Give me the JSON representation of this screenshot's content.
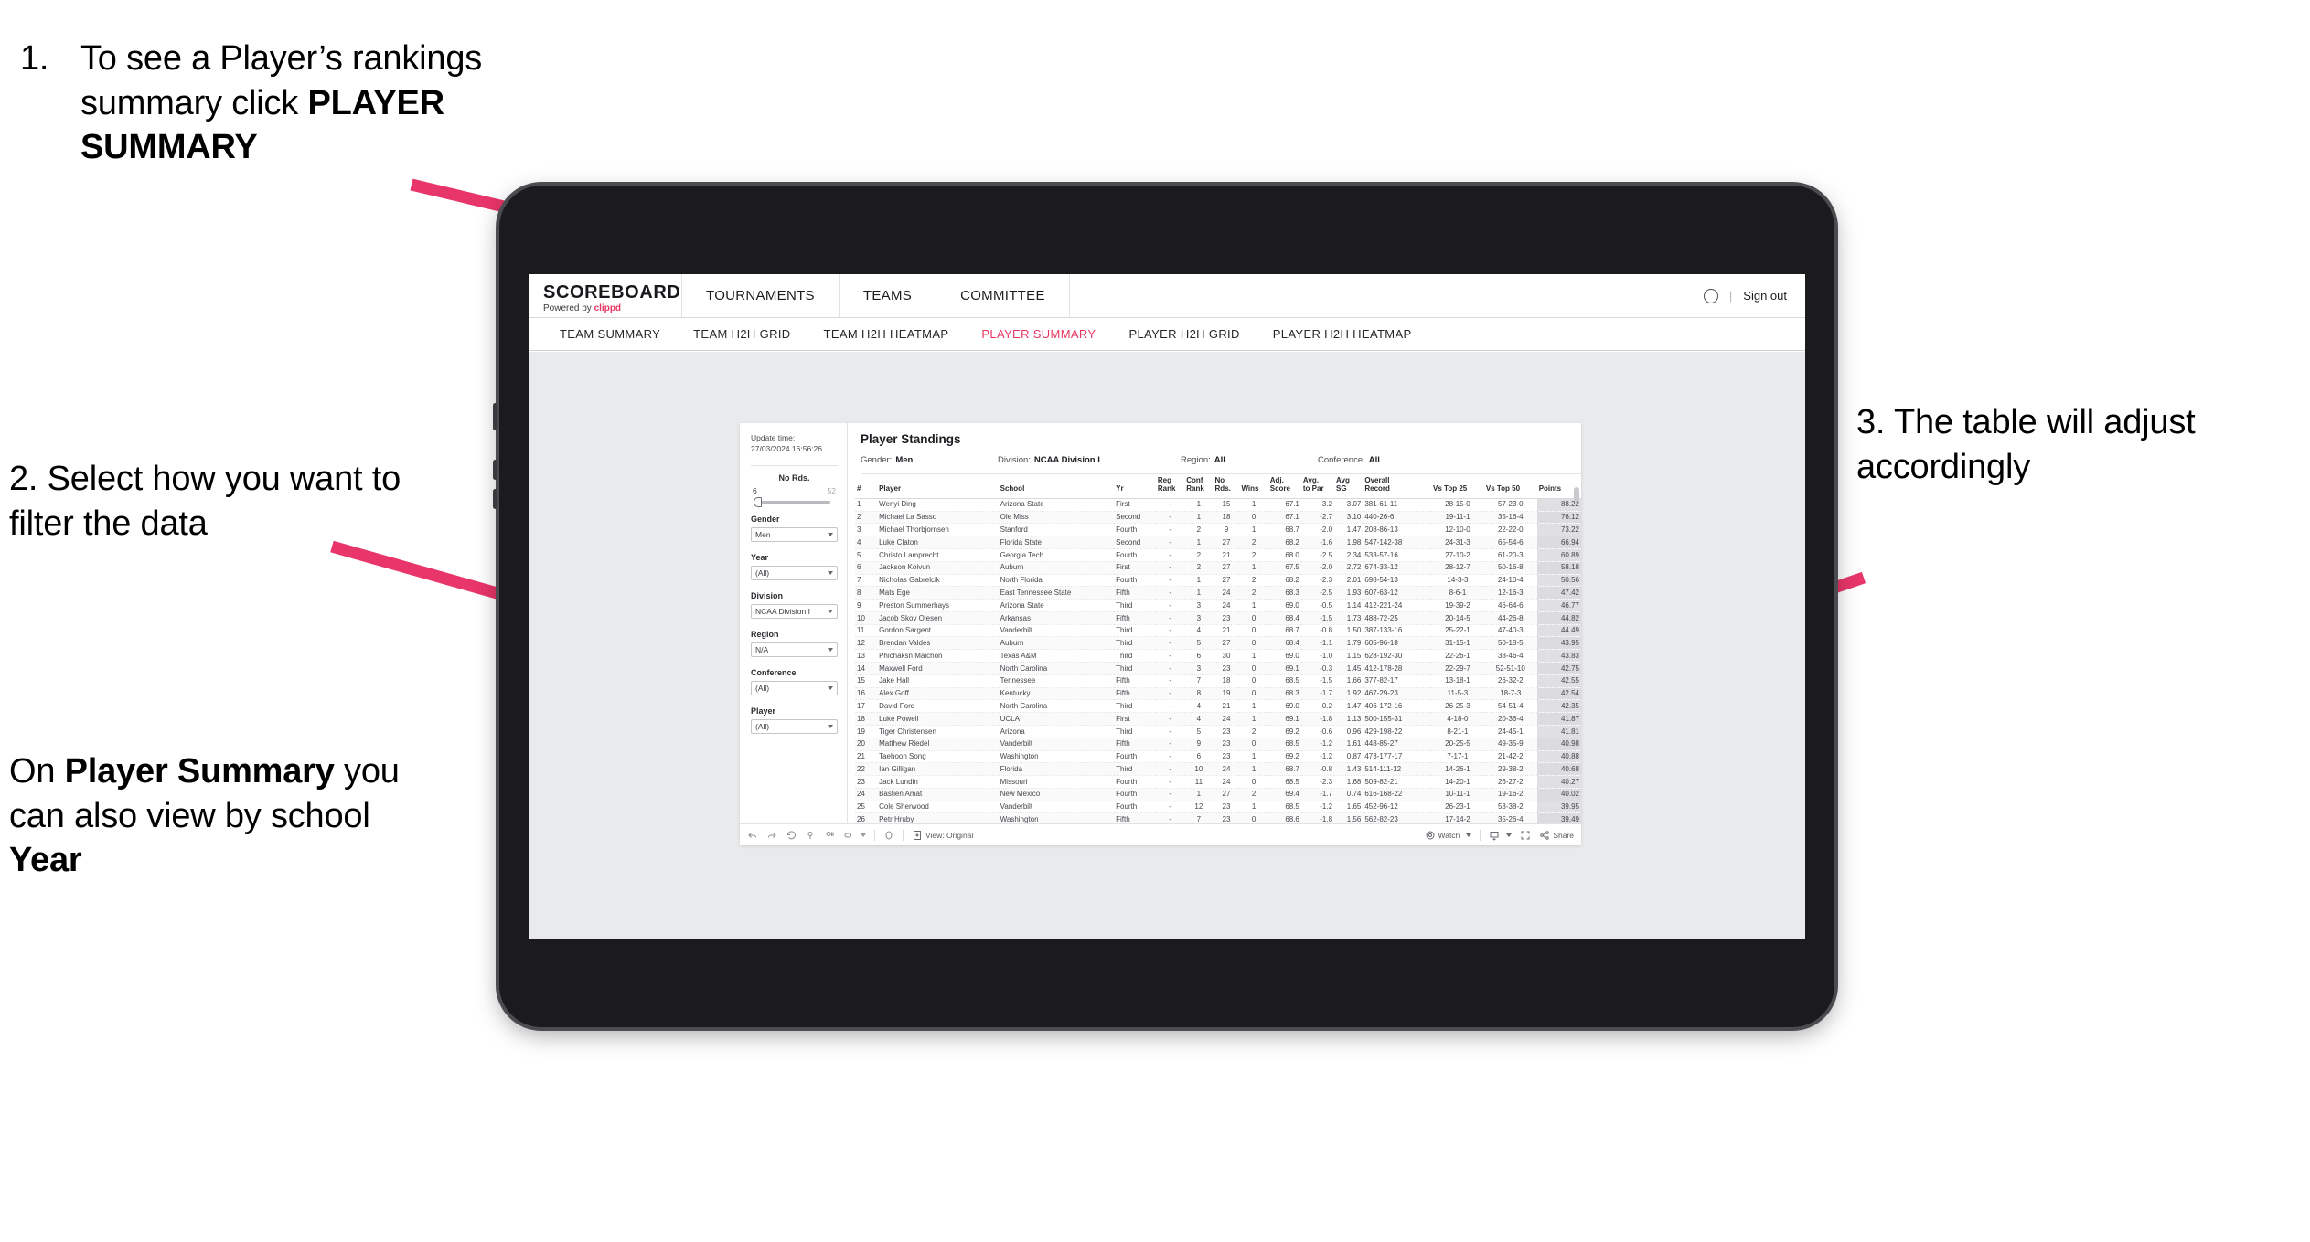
{
  "annotations": {
    "step1": {
      "number": "1.",
      "text_before": "To see a Player’s rankings summary click ",
      "bold": "PLAYER SUMMARY"
    },
    "step2": {
      "line": "2. Select how you want to filter the data"
    },
    "step3": {
      "pre": "On ",
      "bold1": "Player Summary",
      "mid": " you can also view by school ",
      "bold2": "Year"
    },
    "step4": {
      "line": "3. The table will adjust accordingly"
    },
    "accent_color": "#e8356a"
  },
  "app": {
    "brand": {
      "logo": "SCOREBOARD",
      "powered_prefix": "Powered by ",
      "powered_brand": "clippd"
    },
    "topnav": [
      "TOURNAMENTS",
      "TEAMS",
      "COMMITTEE"
    ],
    "topbar_right": {
      "divider": "|",
      "sign_out": "Sign out"
    },
    "subnav": {
      "items": [
        "TEAM SUMMARY",
        "TEAM H2H GRID",
        "TEAM H2H HEATMAP",
        "PLAYER SUMMARY",
        "PLAYER H2H GRID",
        "PLAYER H2H HEATMAP"
      ],
      "active_index": 3,
      "active_color": "#e8355f"
    }
  },
  "viz": {
    "update_time_label": "Update time:",
    "update_time_value": "27/03/2024 16:56:26",
    "title": "Player Standings",
    "subfilters": [
      {
        "label": "Gender:",
        "value": "Men"
      },
      {
        "label": "Division:",
        "value": "NCAA Division I"
      },
      {
        "label": "Region:",
        "value": "All"
      },
      {
        "label": "Conference:",
        "value": "All"
      }
    ],
    "slider": {
      "label": "No Rds.",
      "min": "6",
      "max": "52",
      "value": "6"
    },
    "filters": [
      {
        "label": "Gender",
        "value": "Men"
      },
      {
        "label": "Year",
        "value": "(All)"
      },
      {
        "label": "Division",
        "value": "NCAA Division I"
      },
      {
        "label": "Region",
        "value": "N/A"
      },
      {
        "label": "Conference",
        "value": "(All)"
      },
      {
        "label": "Player",
        "value": "(All)"
      }
    ],
    "toolbar": {
      "view_label": "View: Original",
      "watch_label": "Watch",
      "share_label": "Share"
    }
  },
  "table": {
    "columns": [
      "#",
      "Player",
      "School",
      "Yr",
      "Reg Rank",
      "Conf Rank",
      "No Rds.",
      "Wins",
      "Adj. Score",
      "Avg. to Par",
      "Avg SG",
      "Overall Record",
      "Vs Top 25",
      "Vs Top 50",
      "Points"
    ],
    "columns_wrapped": [
      [
        "#",
        ""
      ],
      [
        "Player",
        ""
      ],
      [
        "School",
        ""
      ],
      [
        "Yr",
        ""
      ],
      [
        "Reg",
        "Rank"
      ],
      [
        "Conf",
        "Rank"
      ],
      [
        "No",
        "Rds."
      ],
      [
        "",
        "Wins"
      ],
      [
        "Adj.",
        "Score"
      ],
      [
        "Avg.",
        "to Par"
      ],
      [
        "Avg",
        "SG"
      ],
      [
        "Overall",
        "Record"
      ],
      [
        "",
        "Vs Top 25"
      ],
      [
        "",
        "Vs Top 50"
      ],
      [
        "",
        "Points"
      ]
    ],
    "rows": [
      [
        "1",
        "Wenyi Ding",
        "Arizona State",
        "First",
        "-",
        "1",
        "15",
        "1",
        "67.1",
        "-3.2",
        "3.07",
        "381-61-11",
        "28-15-0",
        "57-23-0",
        "88.22"
      ],
      [
        "2",
        "Michael La Sasso",
        "Ole Miss",
        "Second",
        "-",
        "1",
        "18",
        "0",
        "67.1",
        "-2.7",
        "3.10",
        "440-26-6",
        "19-11-1",
        "35-16-4",
        "76.12"
      ],
      [
        "3",
        "Michael Thorbjornsen",
        "Stanford",
        "Fourth",
        "-",
        "2",
        "9",
        "1",
        "68.7",
        "-2.0",
        "1.47",
        "208-86-13",
        "12-10-0",
        "22-22-0",
        "73.22"
      ],
      [
        "4",
        "Luke Claton",
        "Florida State",
        "Second",
        "-",
        "1",
        "27",
        "2",
        "68.2",
        "-1.6",
        "1.98",
        "547-142-38",
        "24-31-3",
        "65-54-6",
        "66.94"
      ],
      [
        "5",
        "Christo Lamprecht",
        "Georgia Tech",
        "Fourth",
        "-",
        "2",
        "21",
        "2",
        "68.0",
        "-2.5",
        "2.34",
        "533-57-16",
        "27-10-2",
        "61-20-3",
        "60.89"
      ],
      [
        "6",
        "Jackson Koivun",
        "Auburn",
        "First",
        "-",
        "2",
        "27",
        "1",
        "67.5",
        "-2.0",
        "2.72",
        "674-33-12",
        "28-12-7",
        "50-16-8",
        "58.18"
      ],
      [
        "7",
        "Nicholas Gabrelcik",
        "North Florida",
        "Fourth",
        "-",
        "1",
        "27",
        "2",
        "68.2",
        "-2.3",
        "2.01",
        "698-54-13",
        "14-3-3",
        "24-10-4",
        "50.56"
      ],
      [
        "8",
        "Mats Ege",
        "East Tennessee State",
        "Fifth",
        "-",
        "1",
        "24",
        "2",
        "68.3",
        "-2.5",
        "1.93",
        "607-63-12",
        "8-6-1",
        "12-16-3",
        "47.42"
      ],
      [
        "9",
        "Preston Summerhays",
        "Arizona State",
        "Third",
        "-",
        "3",
        "24",
        "1",
        "69.0",
        "-0.5",
        "1.14",
        "412-221-24",
        "19-39-2",
        "46-64-6",
        "46.77"
      ],
      [
        "10",
        "Jacob Skov Olesen",
        "Arkansas",
        "Fifth",
        "-",
        "3",
        "23",
        "0",
        "68.4",
        "-1.5",
        "1.73",
        "488-72-25",
        "20-14-5",
        "44-26-8",
        "44.82"
      ],
      [
        "11",
        "Gordon Sargent",
        "Vanderbilt",
        "Third",
        "-",
        "4",
        "21",
        "0",
        "68.7",
        "-0.8",
        "1.50",
        "387-133-16",
        "25-22-1",
        "47-40-3",
        "44.49"
      ],
      [
        "12",
        "Brendan Valdes",
        "Auburn",
        "Third",
        "-",
        "5",
        "27",
        "0",
        "68.4",
        "-1.1",
        "1.79",
        "605-96-18",
        "31-15-1",
        "50-18-5",
        "43.95"
      ],
      [
        "13",
        "Phichaksn Maichon",
        "Texas A&M",
        "Third",
        "-",
        "6",
        "30",
        "1",
        "69.0",
        "-1.0",
        "1.15",
        "628-192-30",
        "22-26-1",
        "38-46-4",
        "43.83"
      ],
      [
        "14",
        "Maxwell Ford",
        "North Carolina",
        "Third",
        "-",
        "3",
        "23",
        "0",
        "69.1",
        "-0.3",
        "1.45",
        "412-178-28",
        "22-29-7",
        "52-51-10",
        "42.75"
      ],
      [
        "15",
        "Jake Hall",
        "Tennessee",
        "Fifth",
        "-",
        "7",
        "18",
        "0",
        "68.5",
        "-1.5",
        "1.66",
        "377-82-17",
        "13-18-1",
        "26-32-2",
        "42.55"
      ],
      [
        "16",
        "Alex Goff",
        "Kentucky",
        "Fifth",
        "-",
        "8",
        "19",
        "0",
        "68.3",
        "-1.7",
        "1.92",
        "467-29-23",
        "11-5-3",
        "18-7-3",
        "42.54"
      ],
      [
        "17",
        "David Ford",
        "North Carolina",
        "Third",
        "-",
        "4",
        "21",
        "1",
        "69.0",
        "-0.2",
        "1.47",
        "406-172-16",
        "26-25-3",
        "54-51-4",
        "42.35"
      ],
      [
        "18",
        "Luke Powell",
        "UCLA",
        "First",
        "-",
        "4",
        "24",
        "1",
        "69.1",
        "-1.8",
        "1.13",
        "500-155-31",
        "4-18-0",
        "20-36-4",
        "41.87"
      ],
      [
        "19",
        "Tiger Christensen",
        "Arizona",
        "Third",
        "-",
        "5",
        "23",
        "2",
        "69.2",
        "-0.6",
        "0.96",
        "429-198-22",
        "8-21-1",
        "24-45-1",
        "41.81"
      ],
      [
        "20",
        "Matthew Riedel",
        "Vanderbilt",
        "Fifth",
        "-",
        "9",
        "23",
        "0",
        "68.5",
        "-1.2",
        "1.61",
        "448-85-27",
        "20-25-5",
        "49-35-9",
        "40.98"
      ],
      [
        "21",
        "Taehoon Song",
        "Washington",
        "Fourth",
        "-",
        "6",
        "23",
        "1",
        "69.2",
        "-1.2",
        "0.87",
        "473-177-17",
        "7-17-1",
        "21-42-2",
        "40.88"
      ],
      [
        "22",
        "Ian Gilligan",
        "Florida",
        "Third",
        "-",
        "10",
        "24",
        "1",
        "68.7",
        "-0.8",
        "1.43",
        "514-111-12",
        "14-26-1",
        "29-38-2",
        "40.68"
      ],
      [
        "23",
        "Jack Lundin",
        "Missouri",
        "Fourth",
        "-",
        "11",
        "24",
        "0",
        "68.5",
        "-2.3",
        "1.68",
        "509-82-21",
        "14-20-1",
        "26-27-2",
        "40.27"
      ],
      [
        "24",
        "Bastien Amat",
        "New Mexico",
        "Fourth",
        "-",
        "1",
        "27",
        "2",
        "69.4",
        "-1.7",
        "0.74",
        "616-168-22",
        "10-11-1",
        "19-16-2",
        "40.02"
      ],
      [
        "25",
        "Cole Sherwood",
        "Vanderbilt",
        "Fourth",
        "-",
        "12",
        "23",
        "1",
        "68.5",
        "-1.2",
        "1.65",
        "452-96-12",
        "26-23-1",
        "53-38-2",
        "39.95"
      ],
      [
        "26",
        "Petr Hruby",
        "Washington",
        "Fifth",
        "-",
        "7",
        "23",
        "0",
        "68.6",
        "-1.8",
        "1.56",
        "562-82-23",
        "17-14-2",
        "35-26-4",
        "39.49"
      ]
    ]
  }
}
